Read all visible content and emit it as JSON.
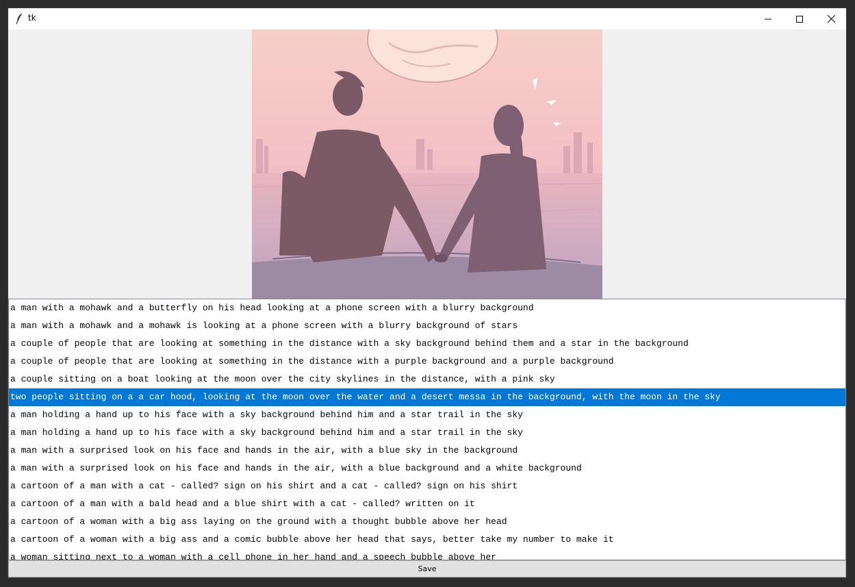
{
  "window": {
    "title": "tk"
  },
  "captions": [
    "a man with a mohawk and a butterfly on his head looking at a phone screen with a blurry background",
    "a man with a mohawk and a mohawk is looking at a phone screen with a blurry background of stars",
    "a couple of people that are looking at something in the distance with a sky background behind them and a star in the background",
    "a couple of people that are looking at something in the distance with a purple background and a purple background",
    "a couple sitting on a boat looking at the moon over the city skylines in the distance, with a pink sky",
    "two people sitting on a a car hood, looking at the moon over the water and a desert messa in the background, with the moon in the sky",
    "a man holding a hand up to his face with a sky background behind him and a star trail in the sky",
    "a man holding a hand up to his face with a sky background behind him and a star trail in the sky",
    "a man with a surprised look on his face and hands in the air, with a blue sky in the background",
    "a man with a surprised look on his face and hands in the air, with a blue background and a white background",
    "a cartoon of a man with a cat - called? sign on his shirt and a cat - called? sign on his shirt",
    "a cartoon of a man with a bald head and a blue shirt with a cat - called? written on it",
    "a cartoon of a woman with a big ass laying on the ground with a thought bubble above her head",
    "a cartoon of a woman with a big ass and a comic bubble above her head that says, better take my number to make it",
    "a woman sitting next to a woman with a cell phone in her hand and a speech bubble above her"
  ],
  "selected_index": 5,
  "save_button": {
    "label": "Save"
  },
  "colors": {
    "selection": "#0078d7",
    "sky_top": "#f6c9c4",
    "sky_bottom": "#b9a7c0"
  },
  "icons": {
    "app": "feather-icon",
    "minimize": "minimize-icon",
    "maximize": "maximize-icon",
    "close": "close-icon"
  }
}
